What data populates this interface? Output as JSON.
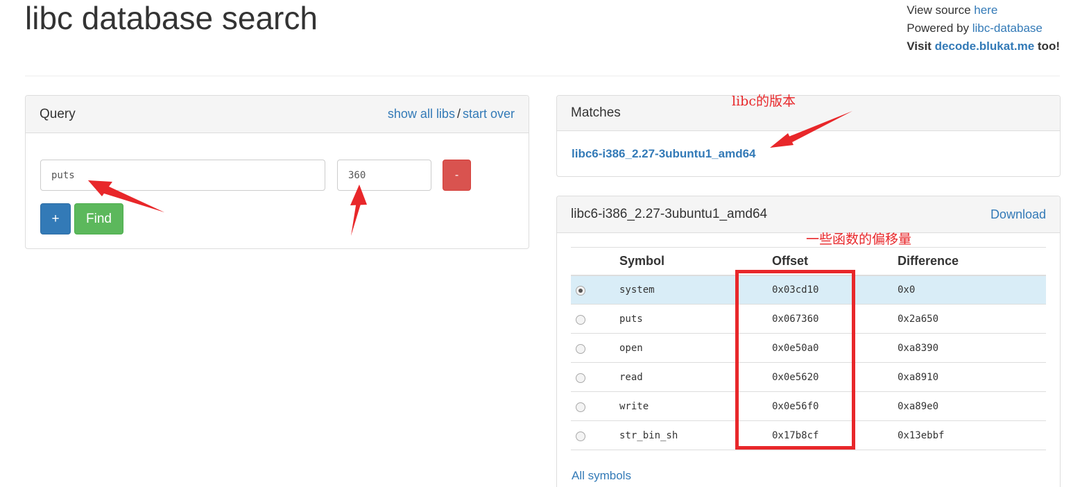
{
  "header": {
    "title": "libc database search",
    "view_source_prefix": "View source ",
    "view_source_link": "here",
    "powered_by_prefix": "Powered by ",
    "powered_by_link": "libc-database",
    "visit_prefix": "Visit ",
    "visit_link": "decode.blukat.me",
    "visit_suffix": " too!"
  },
  "query": {
    "heading": "Query",
    "show_all_libs": "show all libs",
    "separator": "/",
    "start_over": "start over",
    "symbol_value": "puts",
    "offset_value": "360",
    "remove_label": "-",
    "add_label": "+",
    "find_label": "Find"
  },
  "matches": {
    "heading": "Matches",
    "items": [
      "libc6-i386_2.27-3ubuntu1_amd64"
    ]
  },
  "lib": {
    "heading": "libc6-i386_2.27-3ubuntu1_amd64",
    "download_label": "Download",
    "columns": [
      "",
      "Symbol",
      "Offset",
      "Difference"
    ],
    "rows": [
      {
        "symbol": "system",
        "offset": "0x03cd10",
        "difference": "0x0",
        "selected": true
      },
      {
        "symbol": "puts",
        "offset": "0x067360",
        "difference": "0x2a650",
        "selected": false
      },
      {
        "symbol": "open",
        "offset": "0x0e50a0",
        "difference": "0xa8390",
        "selected": false
      },
      {
        "symbol": "read",
        "offset": "0x0e5620",
        "difference": "0xa8910",
        "selected": false
      },
      {
        "symbol": "write",
        "offset": "0x0e56f0",
        "difference": "0xa89e0",
        "selected": false
      },
      {
        "symbol": "str_bin_sh",
        "offset": "0x17b8cf",
        "difference": "0x13ebbf",
        "selected": false
      }
    ],
    "all_symbols_label": "All symbols"
  },
  "annotations": {
    "version_note": "libc的版本",
    "offsets_note": "一些函数的偏移量",
    "color": "#e8272a"
  }
}
